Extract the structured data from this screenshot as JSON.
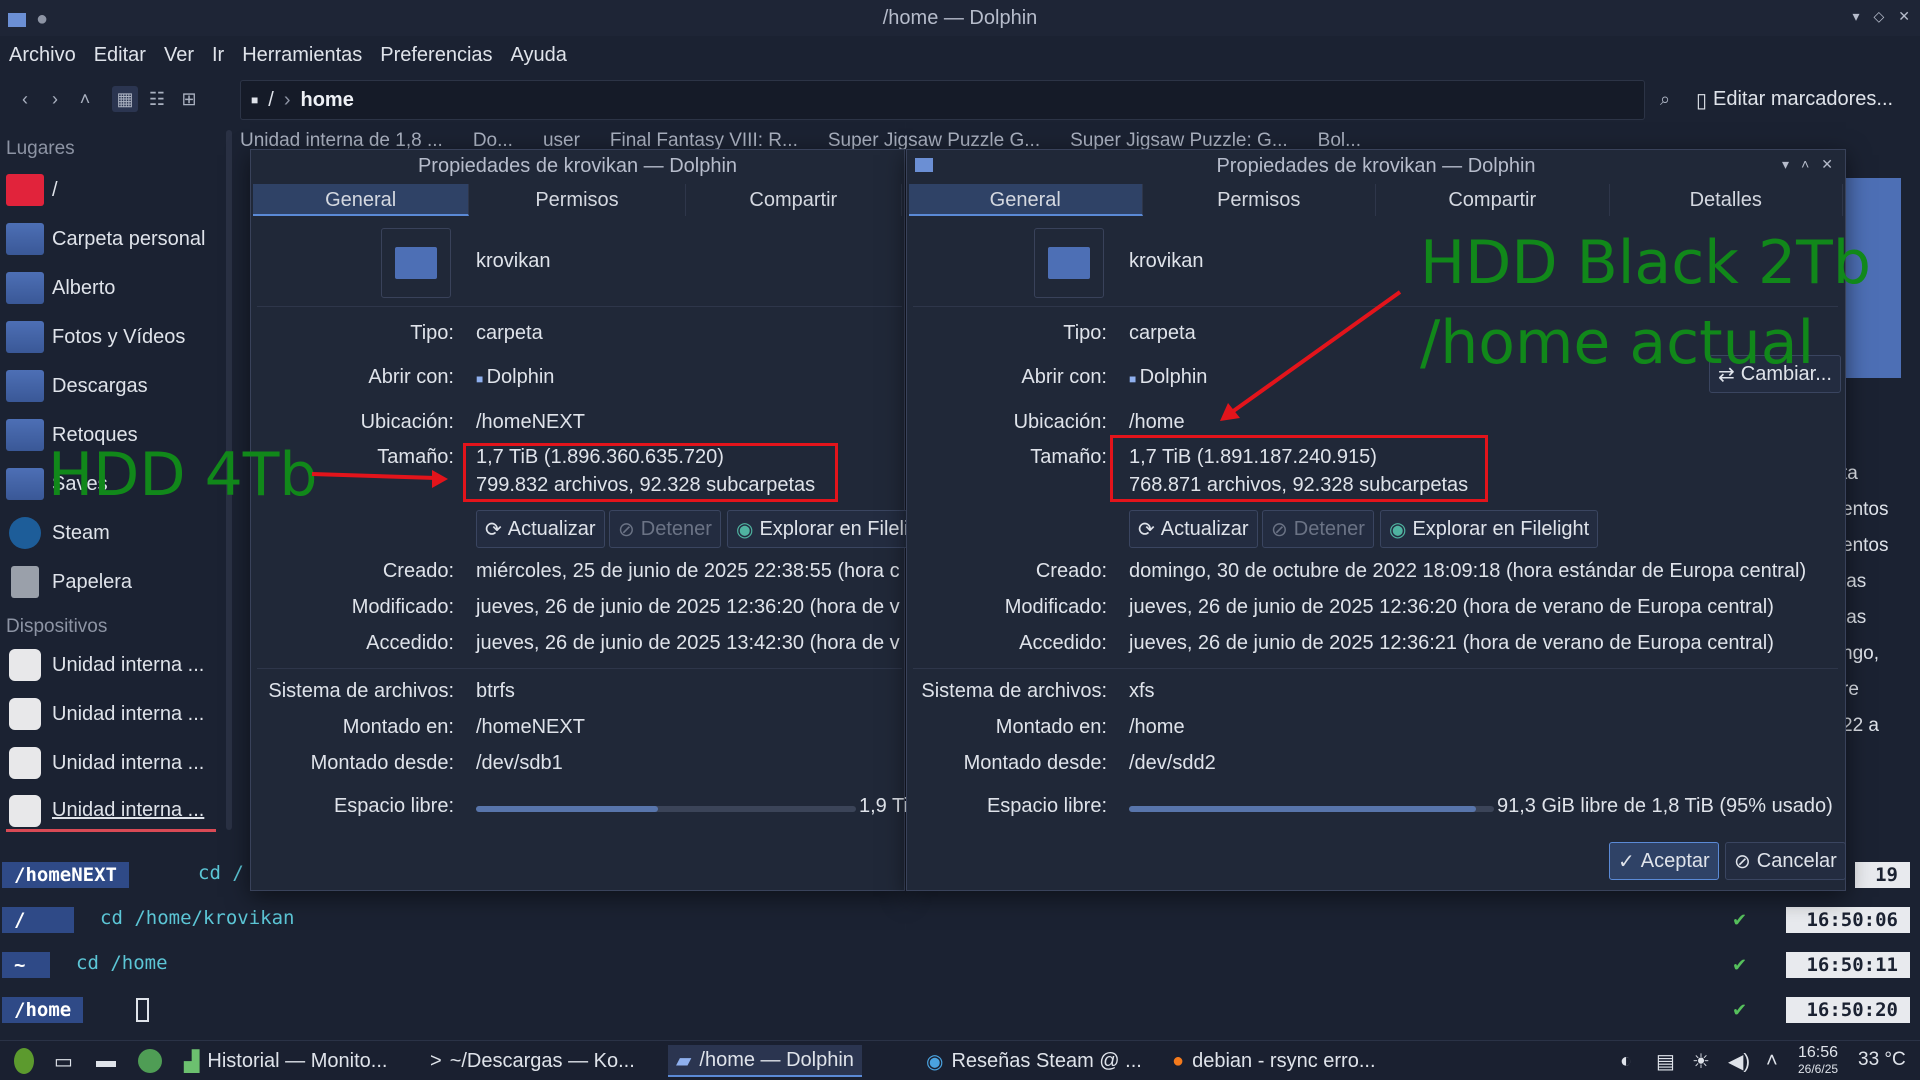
{
  "window": {
    "title": "/home — Dolphin"
  },
  "menu": [
    "Archivo",
    "Editar",
    "Ver",
    "Ir",
    "Herramientas",
    "Preferencias",
    "Ayuda"
  ],
  "url": {
    "root": "/",
    "current": "home"
  },
  "bookmarks": "Editar marcadores...",
  "sidebar": {
    "places_header": "Lugares",
    "places": [
      "/",
      "Carpeta personal",
      "Alberto",
      "Fotos y Vídeos",
      "Descargas",
      "Retoques",
      "Saves",
      "Steam",
      "Papelera"
    ],
    "devices_header": "Dispositivos",
    "devices": [
      "Unidad interna ...",
      "Unidad interna ...",
      "Unidad interna ...",
      "Unidad interna ..."
    ]
  },
  "tabs": [
    "Unidad interna de 1,8 ...",
    "Do...",
    "user",
    "Final Fantasy VIII: R...",
    "Super Jigsaw Puzzle G...",
    "Super Jigsaw Puzzle: G...",
    "Bol..."
  ],
  "dialog_left": {
    "title": "Propiedades de krovikan — Dolphin",
    "tabs": [
      "General",
      "Permisos",
      "Compartir"
    ],
    "name": "krovikan",
    "tipo_l": "Tipo:",
    "tipo": "carpeta",
    "abrir_l": "Abrir con:",
    "abrir": "Dolphin",
    "ubic_l": "Ubicación:",
    "ubic": "/homeNEXT",
    "tam_l": "Tamaño:",
    "tam1": "1,7 TiB (1.896.360.635.720)",
    "tam2": "799.832 archivos, 92.328 subcarpetas",
    "actualizar": "Actualizar",
    "detener": "Detener",
    "explorar": "Explorar en Filelig",
    "creado_l": "Creado:",
    "creado": "miércoles, 25 de junio de 2025 22:38:55 (hora c",
    "mod_l": "Modificado:",
    "mod": "jueves, 26 de junio de 2025 12:36:20 (hora de v",
    "acc_l": "Accedido:",
    "acc": "jueves, 26 de junio de 2025 13:42:30 (hora de v",
    "fs_l": "Sistema de archivos:",
    "fs": "btrfs",
    "mon_l": "Montado en:",
    "mon": "/homeNEXT",
    "desde_l": "Montado desde:",
    "desde": "/dev/sdb1",
    "libre_l": "Espacio libre:",
    "libre": "1,9 Ti",
    "used": 0.48
  },
  "dialog_right": {
    "title": "Propiedades de krovikan — Dolphin",
    "tabs": [
      "General",
      "Permisos",
      "Compartir",
      "Detalles"
    ],
    "name": "krovikan",
    "tipo_l": "Tipo:",
    "tipo": "carpeta",
    "abrir_l": "Abrir con:",
    "abrir": "Dolphin",
    "cambiar": "Cambiar...",
    "ubic_l": "Ubicación:",
    "ubic": "/home",
    "tam_l": "Tamaño:",
    "tam1": "1,7 TiB (1.891.187.240.915)",
    "tam2": "768.871 archivos, 92.328 subcarpetas",
    "actualizar": "Actualizar",
    "detener": "Detener",
    "explorar": "Explorar en Filelight",
    "creado_l": "Creado:",
    "creado": "domingo, 30 de octubre de 2022 18:09:18 (hora estándar de Europa central)",
    "mod_l": "Modificado:",
    "mod": "jueves, 26 de junio de 2025 12:36:20 (hora de verano de Europa central)",
    "acc_l": "Accedido:",
    "acc": "jueves, 26 de junio de 2025 12:36:21 (hora de verano de Europa central)",
    "fs_l": "Sistema de archivos:",
    "fs": "xfs",
    "mon_l": "Montado en:",
    "mon": "/home",
    "desde_l": "Montado desde:",
    "desde": "/dev/sdd2",
    "libre_l": "Espacio libre:",
    "libre": "91,3 GiB libre de 1,8 TiB (95% usado)",
    "used": 0.95,
    "aceptar": "Aceptar",
    "cancelar": "Cancelar"
  },
  "right_peek": [
    "ta",
    "entos",
    "entos",
    "las",
    "las",
    "ngo,",
    "re",
    "22 a"
  ],
  "annotations": {
    "left": "HDD 4Tb",
    "right1": "HDD Black 2Tb",
    "right2": "/home actual"
  },
  "terminal": [
    {
      "prompt": "/homeNEXT",
      "cmd": "cd /",
      "time": "19"
    },
    {
      "prompt": "/",
      "cmd": "cd /home/krovikan",
      "time": "16:50:06"
    },
    {
      "prompt": "~",
      "cmd": "cd /home",
      "time": "16:50:11"
    },
    {
      "prompt": "/home",
      "cmd": "",
      "time": "16:50:20"
    }
  ],
  "taskbar": {
    "items": [
      "Historial — Monito...",
      "~/Descargas — Ko...",
      "/home — Dolphin",
      "Reseñas Steam @ ...",
      "debian - rsync erro..."
    ],
    "clock": "16:56",
    "date": "26/6/25",
    "temp": "33 °C"
  },
  "colors": {
    "accent": "#5b8ad6",
    "annotation": "#11881a",
    "highlight": "#e3141b"
  }
}
